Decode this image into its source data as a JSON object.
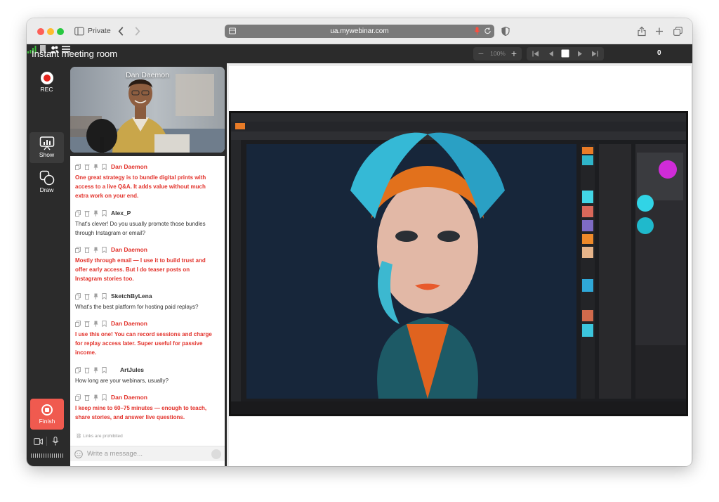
{
  "browser": {
    "private_label": "Private",
    "url": "ua.mywebinar.com"
  },
  "app": {
    "title": "Instant meeting room",
    "zoom": "100%",
    "participants_count": "0"
  },
  "rail": {
    "rec_label": "REC",
    "show_label": "Show",
    "draw_label": "Draw",
    "finish_label": "Finish"
  },
  "speaker": {
    "name": "Dan Daemon"
  },
  "chat": {
    "messages": [
      {
        "author": "Dan Daemon",
        "text": "One great strategy is to bundle digital prints with access to a live Q&A. It adds value without much extra work on your end."
      },
      {
        "author": "Alex_P",
        "text": "That's clever! Do you usually promote those bundles through Instagram or email?"
      },
      {
        "author": "Dan Daemon",
        "text": "Mostly through email — I use it to build trust and offer early access. But I do teaser posts on Instagram stories too."
      },
      {
        "author": "SketchByLena",
        "text": "What's the best platform for hosting paid replays?"
      },
      {
        "author": "Dan Daemon",
        "text": "I use this one! You can record sessions and charge for replay access later. Super useful for passive income."
      },
      {
        "author": "ArtJules",
        "text": "How long are your webinars, usually?"
      },
      {
        "author": "Dan Daemon",
        "text": "I keep mine to 60–75 minutes — enough to teach, share stories, and answer live questions."
      }
    ],
    "links_note": "Links are prohibited",
    "placeholder": "Write a message..."
  },
  "colors": {
    "host_red": "#e2322b",
    "finish_red": "#f05a4f",
    "dark_bg": "#2b2b2b"
  }
}
